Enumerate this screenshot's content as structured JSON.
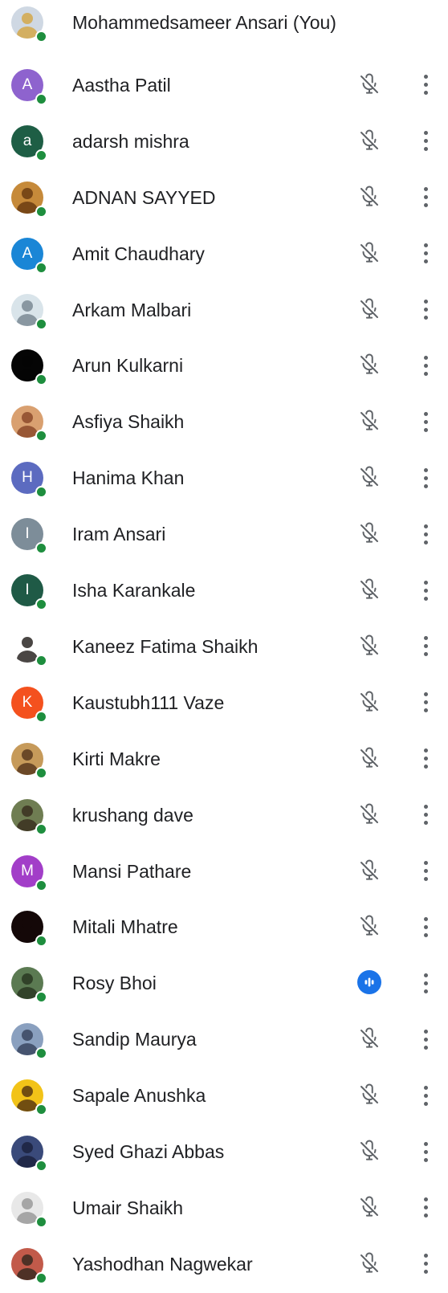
{
  "participants": [
    {
      "name": "Mohammedsameer Ansari (You)",
      "avatar": {
        "type": "photo",
        "bg": "#cfd8e3",
        "accent": "#d4a84a"
      },
      "online": true,
      "status": "self"
    },
    {
      "name": "Aastha Patil",
      "avatar": {
        "type": "initial",
        "letter": "A",
        "bg": "#8e63ce"
      },
      "online": true,
      "status": "muted"
    },
    {
      "name": "adarsh mishra",
      "avatar": {
        "type": "initial",
        "letter": "a",
        "bg": "#1e5e45"
      },
      "online": true,
      "status": "muted"
    },
    {
      "name": "ADNAN SAYYED",
      "avatar": {
        "type": "photo",
        "bg": "#c68a3a",
        "accent": "#6b3c12"
      },
      "online": true,
      "status": "muted"
    },
    {
      "name": "Amit Chaudhary",
      "avatar": {
        "type": "initial",
        "letter": "A",
        "bg": "#1a86d6"
      },
      "online": true,
      "status": "muted"
    },
    {
      "name": "Arkam Malbari",
      "avatar": {
        "type": "photo",
        "bg": "#d9e4ea",
        "accent": "#7a8a94"
      },
      "online": true,
      "status": "muted"
    },
    {
      "name": "Arun Kulkarni",
      "avatar": {
        "type": "photo",
        "bg": "#050505",
        "accent": "#050505"
      },
      "online": true,
      "status": "muted"
    },
    {
      "name": "Asfiya Shaikh",
      "avatar": {
        "type": "photo",
        "bg": "#d9a070",
        "accent": "#8c4a2a"
      },
      "online": true,
      "status": "muted"
    },
    {
      "name": "Hanima Khan",
      "avatar": {
        "type": "initial",
        "letter": "H",
        "bg": "#5c6bc0"
      },
      "online": true,
      "status": "muted"
    },
    {
      "name": "Iram Ansari",
      "avatar": {
        "type": "initial",
        "letter": "I",
        "bg": "#7d8d99"
      },
      "online": true,
      "status": "muted"
    },
    {
      "name": "Isha Karankale",
      "avatar": {
        "type": "initial",
        "letter": "I",
        "bg": "#1f5a46"
      },
      "online": true,
      "status": "muted"
    },
    {
      "name": "Kaneez Fatima Shaikh",
      "avatar": {
        "type": "photo",
        "bg": "#ffffff",
        "accent": "#2a2623"
      },
      "online": true,
      "status": "muted"
    },
    {
      "name": "Kaustubh111 Vaze",
      "avatar": {
        "type": "initial",
        "letter": "K",
        "bg": "#f4511e"
      },
      "online": true,
      "status": "muted"
    },
    {
      "name": "Kirti Makre",
      "avatar": {
        "type": "photo",
        "bg": "#c69a5a",
        "accent": "#5a3a1e"
      },
      "online": true,
      "status": "muted"
    },
    {
      "name": "krushang dave",
      "avatar": {
        "type": "photo",
        "bg": "#6f7d52",
        "accent": "#3b3020"
      },
      "online": true,
      "status": "muted"
    },
    {
      "name": "Mansi Pathare",
      "avatar": {
        "type": "initial",
        "letter": "M",
        "bg": "#a23ec8"
      },
      "online": true,
      "status": "muted"
    },
    {
      "name": "Mitali Mhatre",
      "avatar": {
        "type": "photo",
        "bg": "#140808",
        "accent": "#140808"
      },
      "online": true,
      "status": "muted"
    },
    {
      "name": "Rosy Bhoi",
      "avatar": {
        "type": "photo",
        "bg": "#5b7a52",
        "accent": "#2a3822"
      },
      "online": true,
      "status": "speaking"
    },
    {
      "name": "Sandip Maurya",
      "avatar": {
        "type": "photo",
        "bg": "#8aa0bf",
        "accent": "#3a4660"
      },
      "online": true,
      "status": "muted"
    },
    {
      "name": "Sapale Anushka",
      "avatar": {
        "type": "photo",
        "bg": "#f2c318",
        "accent": "#5a3a10"
      },
      "online": true,
      "status": "muted"
    },
    {
      "name": "Syed Ghazi Abbas",
      "avatar": {
        "type": "photo",
        "bg": "#3a4a7a",
        "accent": "#1c2240"
      },
      "online": true,
      "status": "muted"
    },
    {
      "name": "Umair Shaikh",
      "avatar": {
        "type": "photo",
        "bg": "#e8e8e8",
        "accent": "#9a9a9a"
      },
      "online": true,
      "status": "muted"
    },
    {
      "name": "Yashodhan Nagwekar",
      "avatar": {
        "type": "photo",
        "bg": "#c25a4a",
        "accent": "#3a2a20"
      },
      "online": true,
      "status": "muted"
    }
  ],
  "colors": {
    "presence": "#1e8e3e",
    "muted_icon": "#5f6368",
    "speaking_bg": "#1a73e8",
    "text": "#202124"
  },
  "icons": {
    "muted": "mic-off-icon",
    "speaking": "audio-level-icon",
    "more": "more-vert-icon",
    "presence": "online-status-dot"
  }
}
